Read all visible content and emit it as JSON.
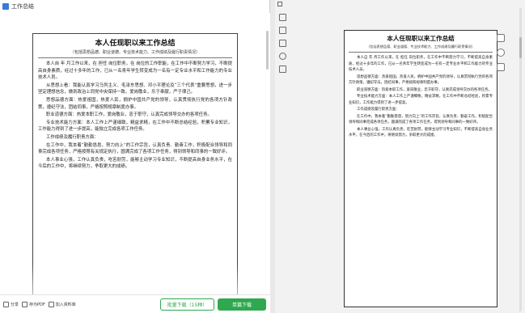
{
  "left_window": {
    "title": "工作总结",
    "document": {
      "title": "本人任现职以来工作总结",
      "subtitle": "（包括思想品德、职业道德、专业技术能力、工作成绩及履行职责情况）",
      "paragraphs": [
        "本人自    年    月工作以来，在    担任     岗位职务，在    岗位的工作职能，在工作中不断努力学习，不断提高自身素质，经过十多年的工作，已从一名青年学生转变成为一名有一定专业水平和工作能力的专业技术人员。",
        "从思想上看：我能认真学习马列主义、毛泽东思想、邓小平理论及“三个代表”重要思想，进一步坚定理想信念，做到政治上同党中央保持一致。爱岗敬业，乐于奉献，严于律己。",
        "思想品德方面：热爱祖国，热爱人民，拥护中国共产党的领导，认真贯彻执行党的各项方针政策，遵纪守法，团结同事，严格按照规章制度办事。",
        "职业道德方面：热爱本职工作，爱岗敬业，忠于职守，认真完成领导交办的各项任务。",
        "专业技术能力方面：本人工作上严谨细致，精益求精，在工作中不断总结经验，积累专业知识，工作能力得到了进一步提高，能独立完成各项工作任务。",
        "工作成绩及履行职责方面：",
        "在工作中，我本着“勤勤恳恳，努力向上”的工作宗旨，认真负责、勤奋工作，积极配合领导和同事完成各项任务，严格按照有关规定执行，圆满完成了各项工作任务，得到领导和同事的一致好评。",
        "本人事业心强，工作认真负责，吃苦耐劳，能够主动学习专业知识，不断提高自身业务水平，在今后的工作中，将继续努力，争取更大的成绩。"
      ]
    },
    "bottom_bar": {
      "share_label": "分享",
      "save_label": "存为PDF",
      "join_label": "加入资料库",
      "batch_label": "批量下载（15种）",
      "batch_badge": "NEW",
      "single_label": "单篇下载"
    }
  },
  "right_window": {
    "document": {
      "title": "本人任现职以来工作总结",
      "subtitle": "（包括思想品德、职业道德、专业技术能力、工作成绩及履行职责情况）",
      "paragraphs": [
        "本人自    年    月工作以来，在    担任     岗位职务，在工作中不断努力学习，不断提高自身素质，经过十多年的工作，已从一名青年学生转变成为一名有一定专业水平和工作能力的专业技术人员。",
        "思想品德方面：热爱祖国，热爱人民，拥护中国共产党的领导，认真贯彻执行党的各项方针政策，遵纪守法，团结同事，严格按照规章制度办事。",
        "职业道德方面：热爱本职工作，爱岗敬业，忠于职守，认真完成领导交办的各项任务。",
        "专业技术能力方面：本人工作上严谨细致，精益求精，在工作中不断总结经验，积累专业知识，工作能力得到了进一步提高。",
        "工作成绩及履行职责方面：",
        "在工作中，我本着“勤勤恳恳，努力向上”的工作宗旨，认真负责、勤奋工作，积极配合领导和同事完成各项任务，圆满完成了各项工作任务，得到领导和同事的一致好评。",
        "本人事业心强，工作认真负责，吃苦耐劳，能够主动学习专业知识，不断提高自身业务水平，在今后的工作中，将继续努力，争取更大的成绩。"
      ]
    }
  },
  "colors": {
    "accent": "#2fa84f",
    "badge": "#e84b3c"
  }
}
